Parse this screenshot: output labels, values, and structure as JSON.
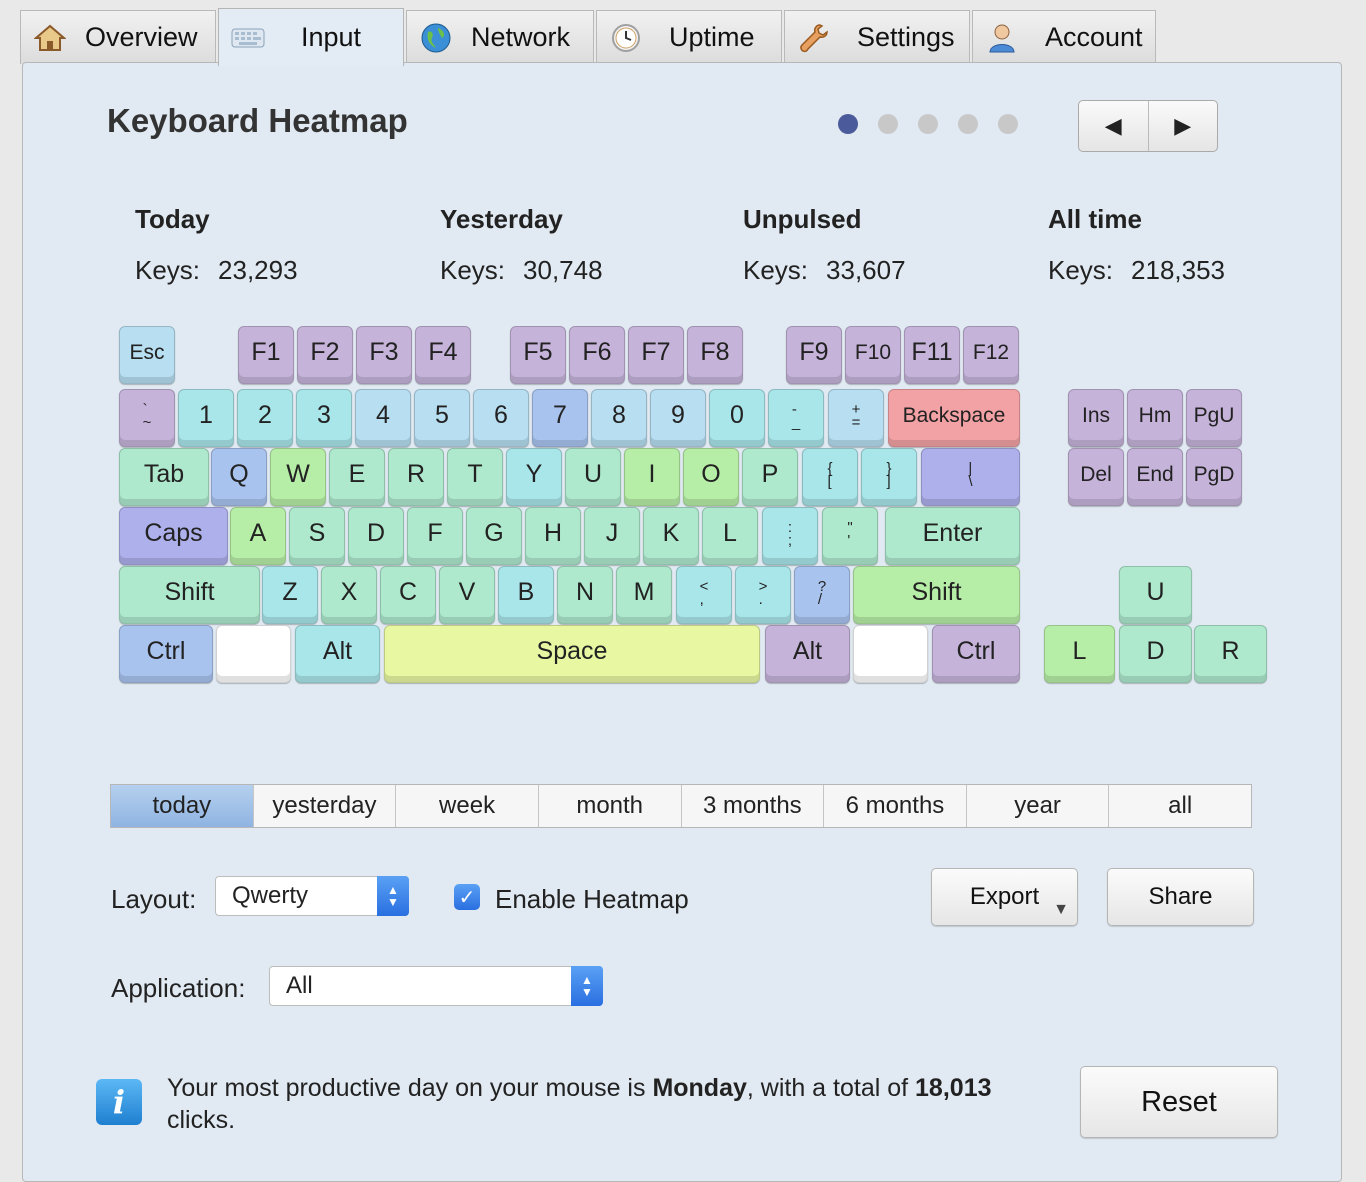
{
  "tabs": [
    {
      "label": "Overview",
      "icon": "home-icon"
    },
    {
      "label": "Input",
      "icon": "keyboard-icon"
    },
    {
      "label": "Network",
      "icon": "globe-icon"
    },
    {
      "label": "Uptime",
      "icon": "clock-icon"
    },
    {
      "label": "Settings",
      "icon": "wrench-icon"
    },
    {
      "label": "Account",
      "icon": "user-icon"
    }
  ],
  "header": {
    "title": "Keyboard Heatmap",
    "page_count": 5,
    "current_page": 1,
    "prev": "◀",
    "next": "▶"
  },
  "stats": [
    {
      "heading": "Today",
      "label": "Keys:",
      "value": "23,293"
    },
    {
      "heading": "Yesterday",
      "label": "Keys:",
      "value": "30,748"
    },
    {
      "heading": "Unpulsed",
      "label": "Keys:",
      "value": "33,607"
    },
    {
      "heading": "All time",
      "label": "Keys:",
      "value": "218,353"
    }
  ],
  "heat_colors": {
    "purple": "#c5b3da",
    "blue": "#b7def1",
    "cyan": "#a9e6ea",
    "mint": "#aee9cd",
    "green": "#b7eea7",
    "yellow": "#e7f7a2",
    "red": "#f2a2a4",
    "indigo": "#aeb0ec",
    "skyblue": "#a9c3ef",
    "white": "#ffffff"
  },
  "keys": [
    {
      "label": "Esc",
      "heat": "blue"
    },
    {
      "label": "F1",
      "heat": "purple"
    },
    {
      "label": "F2",
      "heat": "purple"
    },
    {
      "label": "F3",
      "heat": "purple"
    },
    {
      "label": "F4",
      "heat": "purple"
    },
    {
      "label": "F5",
      "heat": "purple"
    },
    {
      "label": "F6",
      "heat": "purple"
    },
    {
      "label": "F7",
      "heat": "purple"
    },
    {
      "label": "F8",
      "heat": "purple"
    },
    {
      "label": "F9",
      "heat": "purple"
    },
    {
      "label": "F10",
      "heat": "purple"
    },
    {
      "label": "F11",
      "heat": "purple"
    },
    {
      "label": "F12",
      "heat": "purple"
    },
    {
      "label": "` ~",
      "heat": "purple"
    },
    {
      "label": "1",
      "heat": "cyan"
    },
    {
      "label": "2",
      "heat": "cyan"
    },
    {
      "label": "3",
      "heat": "cyan"
    },
    {
      "label": "4",
      "heat": "blue"
    },
    {
      "label": "5",
      "heat": "blue"
    },
    {
      "label": "6",
      "heat": "blue"
    },
    {
      "label": "7",
      "heat": "skyblue"
    },
    {
      "label": "8",
      "heat": "blue"
    },
    {
      "label": "9",
      "heat": "blue"
    },
    {
      "label": "0",
      "heat": "cyan"
    },
    {
      "label": "- _",
      "heat": "cyan"
    },
    {
      "label": "+ =",
      "heat": "blue"
    },
    {
      "label": "Backspace",
      "heat": "red"
    },
    {
      "label": "Tab",
      "heat": "mint"
    },
    {
      "label": "Q",
      "heat": "skyblue"
    },
    {
      "label": "W",
      "heat": "green"
    },
    {
      "label": "E",
      "heat": "mint"
    },
    {
      "label": "R",
      "heat": "mint"
    },
    {
      "label": "T",
      "heat": "mint"
    },
    {
      "label": "Y",
      "heat": "cyan"
    },
    {
      "label": "U",
      "heat": "mint"
    },
    {
      "label": "I",
      "heat": "green"
    },
    {
      "label": "O",
      "heat": "green"
    },
    {
      "label": "P",
      "heat": "mint"
    },
    {
      "label": "{ [",
      "heat": "cyan"
    },
    {
      "label": "} ]",
      "heat": "cyan"
    },
    {
      "label": "| \\",
      "heat": "indigo"
    },
    {
      "label": "Caps",
      "heat": "indigo"
    },
    {
      "label": "A",
      "heat": "green"
    },
    {
      "label": "S",
      "heat": "mint"
    },
    {
      "label": "D",
      "heat": "mint"
    },
    {
      "label": "F",
      "heat": "mint"
    },
    {
      "label": "G",
      "heat": "mint"
    },
    {
      "label": "H",
      "heat": "mint"
    },
    {
      "label": "J",
      "heat": "mint"
    },
    {
      "label": "K",
      "heat": "mint"
    },
    {
      "label": "L",
      "heat": "mint"
    },
    {
      "label": ": ;",
      "heat": "cyan"
    },
    {
      "label": "\" '",
      "heat": "mint"
    },
    {
      "label": "Enter",
      "heat": "mint"
    },
    {
      "label": "Shift",
      "heat": "mint"
    },
    {
      "label": "Z",
      "heat": "cyan"
    },
    {
      "label": "X",
      "heat": "mint"
    },
    {
      "label": "C",
      "heat": "mint"
    },
    {
      "label": "V",
      "heat": "mint"
    },
    {
      "label": "B",
      "heat": "cyan"
    },
    {
      "label": "N",
      "heat": "mint"
    },
    {
      "label": "M",
      "heat": "mint"
    },
    {
      "label": "< ,",
      "heat": "cyan"
    },
    {
      "label": "> .",
      "heat": "cyan"
    },
    {
      "label": "? /",
      "heat": "skyblue"
    },
    {
      "label": "Shift",
      "heat": "green"
    },
    {
      "label": "Ctrl",
      "heat": "skyblue"
    },
    {
      "label": "",
      "heat": "white"
    },
    {
      "label": "Alt",
      "heat": "cyan"
    },
    {
      "label": "Space",
      "heat": "yellow"
    },
    {
      "label": "Alt",
      "heat": "purple"
    },
    {
      "label": "",
      "heat": "white"
    },
    {
      "label": "Ctrl",
      "heat": "purple"
    },
    {
      "label": "Ins",
      "heat": "purple"
    },
    {
      "label": "Hm",
      "heat": "purple"
    },
    {
      "label": "PgU",
      "heat": "purple"
    },
    {
      "label": "Del",
      "heat": "purple"
    },
    {
      "label": "End",
      "heat": "purple"
    },
    {
      "label": "PgD",
      "heat": "purple"
    },
    {
      "label": "U",
      "heat": "mint"
    },
    {
      "label": "L",
      "heat": "green"
    },
    {
      "label": "D",
      "heat": "mint"
    },
    {
      "label": "R",
      "heat": "mint"
    }
  ],
  "ranges": [
    "today",
    "yesterday",
    "week",
    "month",
    "3 months",
    "6 months",
    "year",
    "all"
  ],
  "selected_range": "today",
  "controls": {
    "layout_label": "Layout:",
    "layout_value": "Qwerty",
    "enable_heatmap_label": "Enable Heatmap",
    "enable_heatmap_checked": true,
    "export_label": "Export",
    "export_arrow": "▼",
    "share_label": "Share",
    "application_label": "Application:",
    "application_value": "All"
  },
  "info": {
    "text_before": "Your most productive day on your mouse is ",
    "day": "Monday",
    "text_mid": ", with a total of ",
    "clicks": "18,013",
    "text_after": " clicks."
  },
  "reset_label": "Reset"
}
